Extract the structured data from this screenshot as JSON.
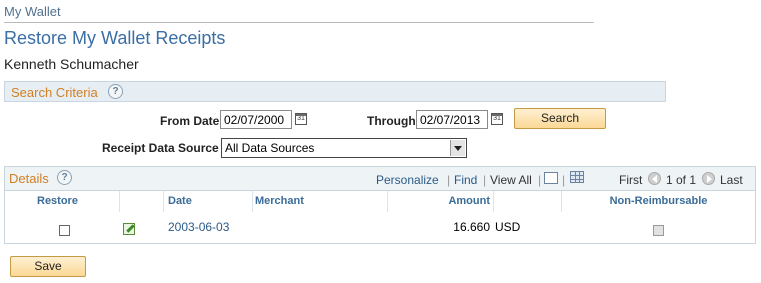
{
  "breadcrumb": "My Wallet",
  "page_title": "Restore My Wallet Receipts",
  "user_name": "Kenneth Schumacher",
  "search_criteria": {
    "title": "Search Criteria",
    "from_date_label": "From Date",
    "from_date_value": "02/07/2000",
    "through_label": "Through",
    "through_value": "02/07/2013",
    "search_button": "Search",
    "source_label": "Receipt Data Source",
    "source_value": "All Data Sources"
  },
  "details": {
    "title": "Details",
    "personalize": "Personalize",
    "find": "Find",
    "view_all": "View All",
    "first": "First",
    "range": "1 of 1",
    "last": "Last",
    "columns": [
      "Restore",
      "Date",
      "Merchant",
      "Amount",
      "Non-Reimbursable"
    ],
    "rows": [
      {
        "date": "2003-06-03",
        "merchant": "",
        "amount": "16.660",
        "currency": "USD",
        "restore": false,
        "non_reimbursable": false
      }
    ]
  },
  "save_button": "Save",
  "icons": [
    "help-icon",
    "calendar-icon",
    "dropdown-arrow-icon",
    "zoom-icon",
    "grid-icon",
    "previous-icon",
    "next-icon",
    "edit-icon"
  ],
  "colors": {
    "title": "#3a6ea5",
    "section": "#d17f23",
    "button": "#fbd895"
  }
}
